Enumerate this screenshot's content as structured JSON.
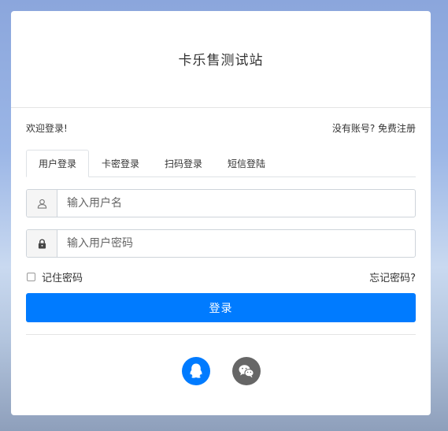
{
  "site": {
    "title": "卡乐售测试站"
  },
  "welcome": {
    "text": "欢迎登录!",
    "register_link": "没有账号? 免费注册"
  },
  "tabs": [
    {
      "label": "用户登录",
      "active": true
    },
    {
      "label": "卡密登录",
      "active": false
    },
    {
      "label": "扫码登录",
      "active": false
    },
    {
      "label": "短信登陆",
      "active": false
    }
  ],
  "form": {
    "username": {
      "placeholder": "输入用户名",
      "value": "",
      "icon": "user-icon"
    },
    "password": {
      "placeholder": "输入用户密码",
      "value": "",
      "icon": "lock-icon"
    },
    "remember_label": "记住密码",
    "remember_checked": false,
    "forgot_label": "忘记密码?",
    "submit_label": "登录"
  },
  "social": [
    {
      "name": "qq",
      "icon": "qq-icon",
      "color": "#007bff"
    },
    {
      "name": "wechat",
      "icon": "wechat-icon",
      "color": "#666666"
    }
  ],
  "colors": {
    "primary": "#007bff",
    "social_gray": "#666666"
  }
}
